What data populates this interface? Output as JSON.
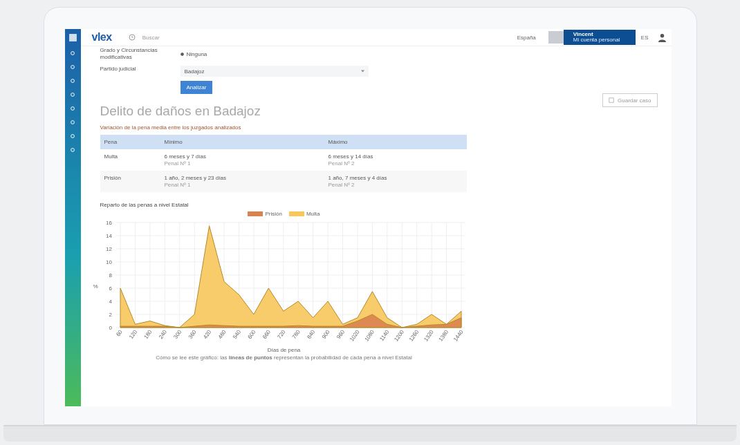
{
  "topbar": {
    "logo": "vlex",
    "search_placeholder": "Buscar",
    "country": "España",
    "account": {
      "title": "Vincent",
      "subtitle": "Mi cuenta personal"
    },
    "language": "ES"
  },
  "form": {
    "fields": [
      {
        "label": "Grado y Circunstancias modificativas",
        "kind": "radio",
        "value": "Ninguna",
        "selected": true
      },
      {
        "label": "Partido judicial",
        "kind": "select",
        "value": "Badajoz"
      }
    ],
    "submit": "Analizar"
  },
  "save_button": "Guardar caso",
  "title": "Delito de daños en Badajoz",
  "subtitle": "Variación de la pena media entre los juzgados analizados",
  "table": {
    "columns": [
      "Pena",
      "Mínimo",
      "Máximo"
    ],
    "rows": [
      {
        "pena": "Multa",
        "min": "6 meses y 7 días",
        "min_court": "Penal Nº 1",
        "max": "6 meses y 14 días",
        "max_court": "Penal Nº 2"
      },
      {
        "pena": "Prisión",
        "min": "1 año, 2 meses y 23 días",
        "min_court": "Penal Nº 1",
        "max": "1 año, 7 meses y 4 días",
        "max_court": "Penal Nº 2"
      }
    ]
  },
  "chart_heading": "Reparto de las penas a nivel Estatal",
  "chart_data": {
    "type": "area",
    "xlabel": "Días de pena",
    "ylabel": "%",
    "stacked": false,
    "grid": true,
    "categories": [
      "60",
      "120",
      "180",
      "240",
      "300",
      "360",
      "420",
      "480",
      "540",
      "600",
      "660",
      "720",
      "780",
      "840",
      "900",
      "960",
      "1020",
      "1080",
      "1140",
      "1200",
      "1260",
      "1320",
      "1380",
      "1440"
    ],
    "ylim": [
      0,
      16
    ],
    "yticks": [
      0,
      2,
      4,
      6,
      8,
      10,
      12,
      14,
      16
    ],
    "series": [
      {
        "name": "Prisión",
        "color": "#d9824f",
        "values": [
          0.2,
          0.2,
          0.2,
          0.2,
          0,
          0.2,
          0.4,
          0.3,
          0.2,
          0.2,
          0.2,
          0.2,
          0.3,
          0.2,
          0.2,
          0.2,
          1,
          2,
          0.5,
          0,
          0.2,
          0.4,
          0.5,
          1.5
        ]
      },
      {
        "name": "Multa",
        "color": "#f7c75a",
        "values": [
          6,
          0.5,
          1,
          0.3,
          0,
          2,
          15.5,
          7,
          5,
          2,
          6,
          2.5,
          4,
          1.5,
          4,
          0.5,
          1.5,
          5.5,
          1.5,
          0,
          0.5,
          2,
          0.5,
          2.5
        ]
      }
    ]
  },
  "footnote": "Cómo se lee este gráfico: las **líneas de puntos** representan la probabilidad de cada pena a nivel Estatal"
}
